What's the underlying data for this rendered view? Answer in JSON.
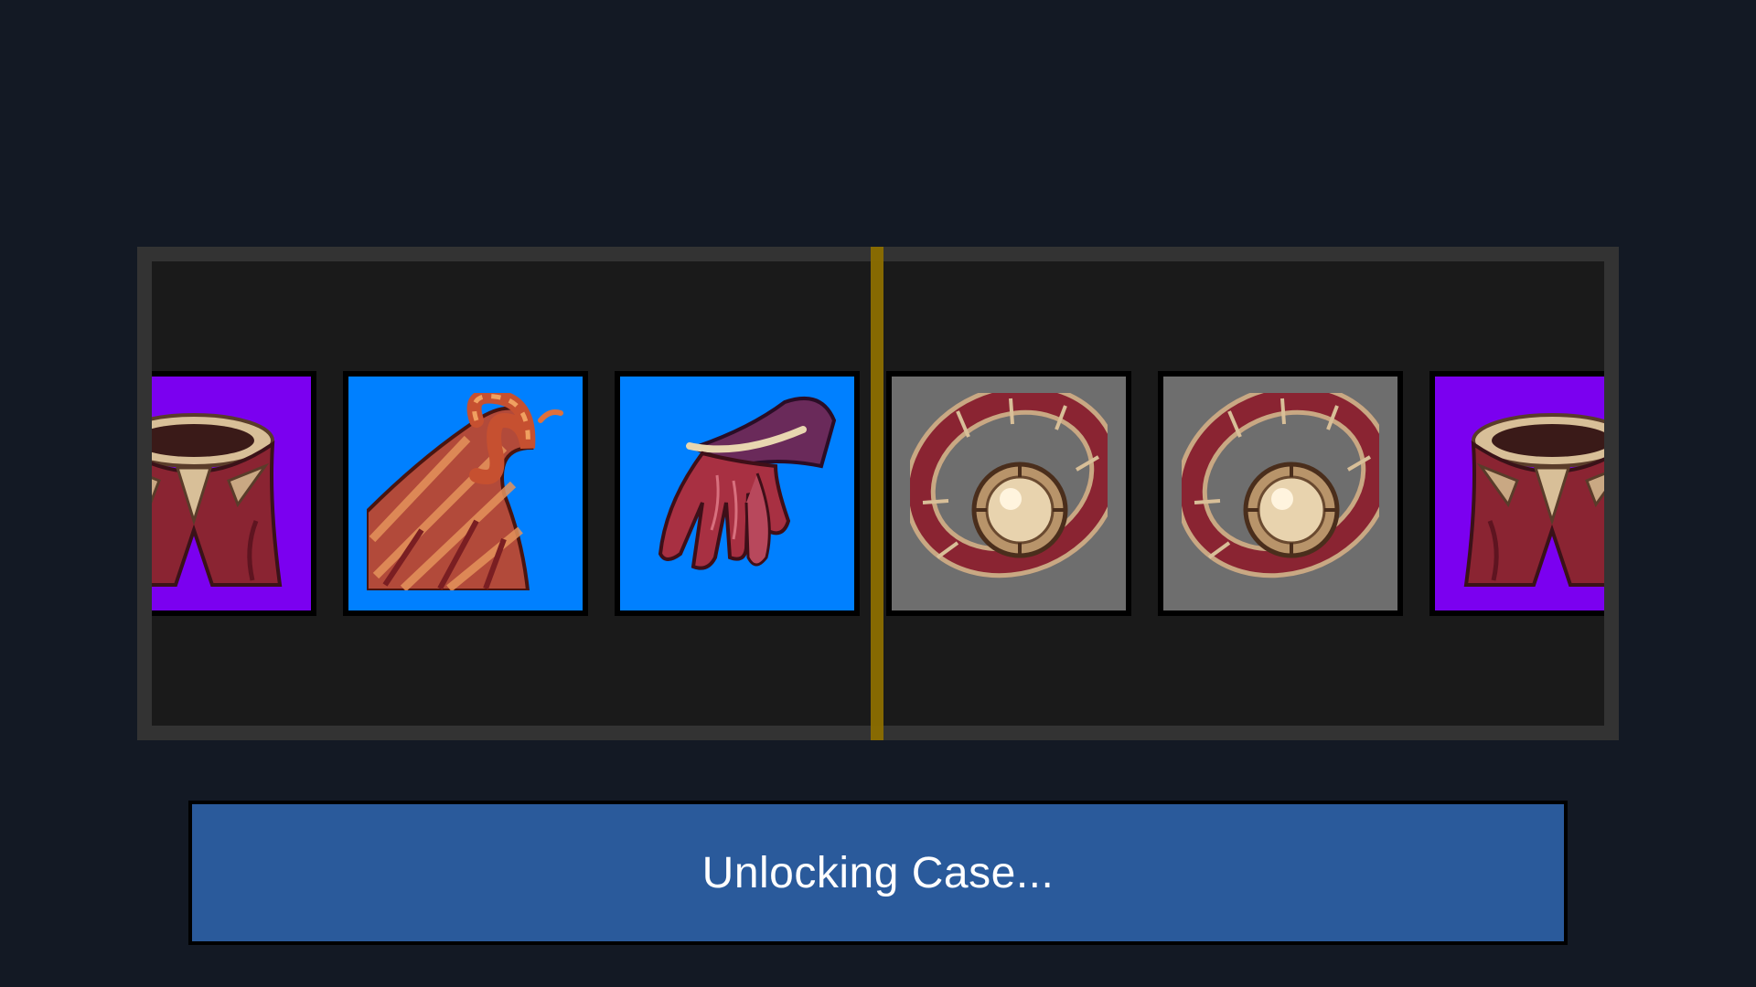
{
  "status": {
    "label": "Unlocking Case..."
  },
  "colors": {
    "background": "#131924",
    "reel_frame": "#333333",
    "reel_window": "#1a1a1a",
    "selector": "#8c6e00",
    "status_bar": "#2a5a9b",
    "rarity_epic": "#7b00f0",
    "rarity_rare": "#0080ff",
    "rarity_common": "#6e6e6e"
  },
  "reel": {
    "items": [
      {
        "name": "Pants",
        "icon": "pants-icon",
        "rarity": "epic"
      },
      {
        "name": "Cape",
        "icon": "cape-icon",
        "rarity": "rare"
      },
      {
        "name": "Gloves",
        "icon": "gloves-icon",
        "rarity": "rare"
      },
      {
        "name": "Belt",
        "icon": "belt-icon",
        "rarity": "common"
      },
      {
        "name": "Belt",
        "icon": "belt-icon",
        "rarity": "common"
      },
      {
        "name": "Pants",
        "icon": "pants-icon",
        "rarity": "epic"
      }
    ]
  }
}
